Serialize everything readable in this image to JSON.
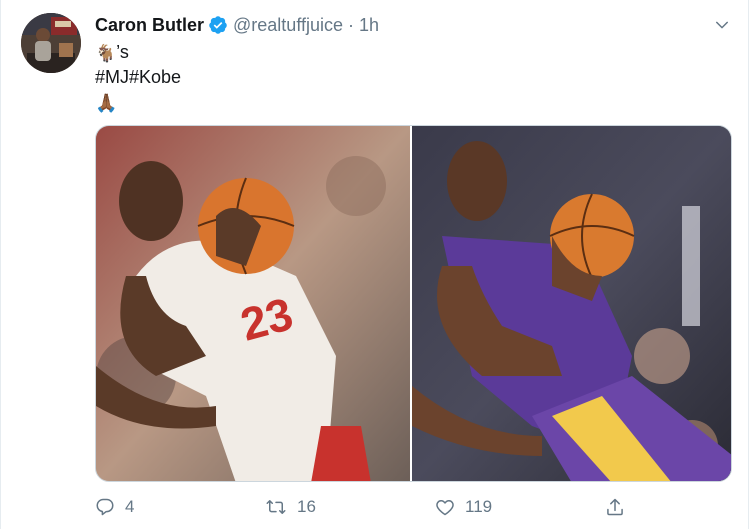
{
  "tweet": {
    "author": {
      "name": "Caron Butler",
      "handle": "@realtuffjuice",
      "separator": "·",
      "time": "1h",
      "verified": true
    },
    "body": {
      "line1_emoji": "🐐",
      "line1_suffix": "’s",
      "hashtags": "#MJ#Kobe",
      "line3_emoji": "🙏🏾"
    },
    "media": {
      "images": [
        {
          "subject": "basketball player in white number 23 jersey holding ball"
        },
        {
          "subject": "basketball player in purple and gold jersey holding ball"
        }
      ]
    },
    "actions": {
      "reply_count": "4",
      "retweet_count": "16",
      "like_count": "119"
    }
  },
  "colors": {
    "text_primary": "#14171a",
    "text_secondary": "#657786",
    "verified_blue": "#1da1f2",
    "border": "#e6ecf0"
  }
}
